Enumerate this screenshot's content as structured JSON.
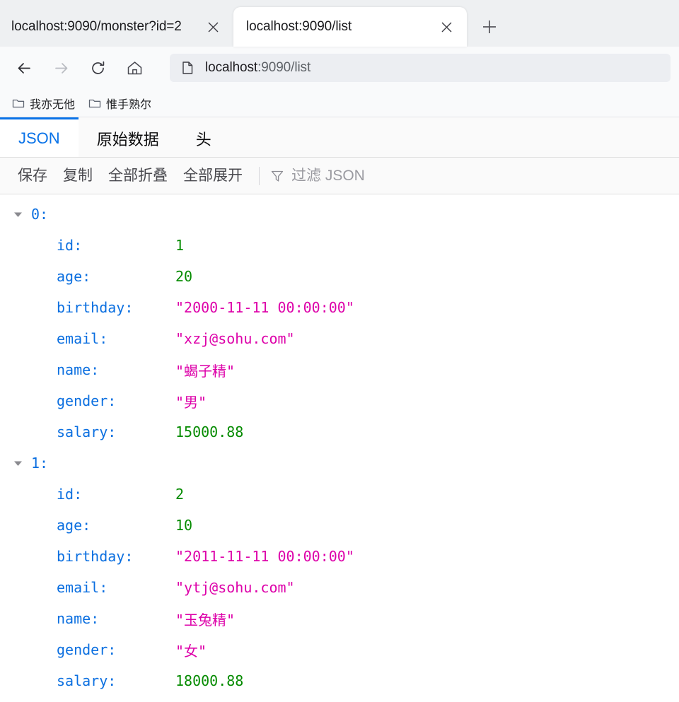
{
  "browser": {
    "tabs": [
      {
        "title": "localhost:9090/monster?id=2",
        "active": false,
        "close_icon": "close-icon"
      },
      {
        "title": "localhost:9090/list",
        "active": true,
        "close_icon": "close-icon"
      }
    ],
    "new_tab_icon": "plus-icon",
    "nav": {
      "back_icon": "back-arrow-icon",
      "forward_icon": "forward-arrow-icon",
      "reload_icon": "reload-icon",
      "home_icon": "home-icon"
    },
    "omnibox": {
      "page_icon": "document-icon",
      "host": "localhost",
      "rest": ":9090/list",
      "full_url": "localhost:9090/list"
    },
    "bookmarks": [
      {
        "label": "我亦无他",
        "icon": "folder-icon"
      },
      {
        "label": "惟手熟尔",
        "icon": "folder-icon"
      }
    ]
  },
  "viewer": {
    "tabs": [
      {
        "label": "JSON",
        "active": true
      },
      {
        "label": "原始数据",
        "active": false
      },
      {
        "label": "头",
        "active": false
      }
    ],
    "toolbar": {
      "save_label": "保存",
      "copy_label": "复制",
      "collapse_all_label": "全部折叠",
      "expand_all_label": "全部展开",
      "filter_icon": "filter-funnel-icon",
      "filter_placeholder": "过滤 JSON",
      "filter_value": ""
    },
    "rows": [
      {
        "index_label": "0:",
        "twisty": "triangle-down-icon",
        "fields": [
          {
            "key": "id:",
            "value": "1",
            "type": "num"
          },
          {
            "key": "age:",
            "value": "20",
            "type": "num"
          },
          {
            "key": "birthday:",
            "value": "\"2000-11-11 00:00:00\"",
            "type": "str"
          },
          {
            "key": "email:",
            "value": "\"xzj@sohu.com\"",
            "type": "str"
          },
          {
            "key": "name:",
            "value": "\"蝎子精\"",
            "type": "str"
          },
          {
            "key": "gender:",
            "value": "\"男\"",
            "type": "str"
          },
          {
            "key": "salary:",
            "value": "15000.88",
            "type": "num"
          }
        ]
      },
      {
        "index_label": "1:",
        "twisty": "triangle-down-icon",
        "fields": [
          {
            "key": "id:",
            "value": "2",
            "type": "num"
          },
          {
            "key": "age:",
            "value": "10",
            "type": "num"
          },
          {
            "key": "birthday:",
            "value": "\"2011-11-11 00:00:00\"",
            "type": "str"
          },
          {
            "key": "email:",
            "value": "\"ytj@sohu.com\"",
            "type": "str"
          },
          {
            "key": "name:",
            "value": "\"玉兔精\"",
            "type": "str"
          },
          {
            "key": "gender:",
            "value": "\"女\"",
            "type": "str"
          },
          {
            "key": "salary:",
            "value": "18000.88",
            "type": "num"
          }
        ]
      }
    ]
  },
  "colors": {
    "accent": "#0a73e8",
    "json_key": "#0b6fe0",
    "json_number": "#058b00",
    "json_string": "#dd00a9"
  }
}
